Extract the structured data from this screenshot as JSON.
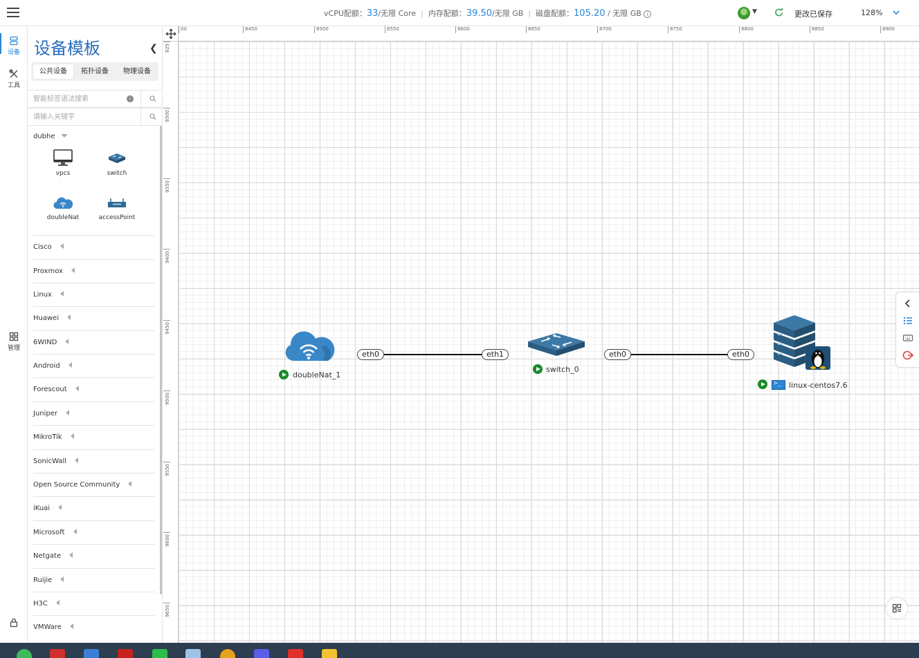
{
  "topbar": {
    "vcpu_label": "vCPU配额：",
    "vcpu_value": "33",
    "vcpu_suffix": "/无限 Core",
    "mem_label": "内存配额：",
    "mem_value": "39.50",
    "mem_suffix": "/无限 GB",
    "disk_label": "磁盘配额：",
    "disk_value": "105.20",
    "disk_suffix": " / 无限 GB",
    "save_status": "更改已保存",
    "zoom": "128%"
  },
  "rail": {
    "device": "设备",
    "tool": "工具",
    "manage": "管理"
  },
  "sidebar": {
    "title": "设备模板",
    "tabs": [
      "公共设备",
      "拓扑设备",
      "物理设备"
    ],
    "search_tag_placeholder": "智能标签语法搜索",
    "search_kw_placeholder": "请输入关键字",
    "open_group": "dubhe",
    "devices": [
      "vpcs",
      "switch",
      "doubleNat",
      "accessPoint"
    ],
    "vendors": [
      "Cisco",
      "Proxmox",
      "Linux",
      "Huawei",
      "6WIND",
      "Android",
      "Forescout",
      "Juniper",
      "MikroTik",
      "SonicWall",
      "Open Source Community",
      "iKuai",
      "Microsoft",
      "Netgate",
      "Ruijie",
      "H3C",
      "VMWare"
    ]
  },
  "ruler": {
    "top": [
      "00",
      "8450",
      "8500",
      "8550",
      "8600",
      "8650",
      "8700",
      "8750",
      "8800",
      "8850",
      "8900"
    ],
    "left": [
      "925",
      "9300",
      "9350",
      "9400",
      "9450",
      "9500",
      "9550",
      "9600",
      "9650"
    ]
  },
  "topology": {
    "nodes": [
      "doubleNat_1",
      "switch_0",
      "linux-centos7.6"
    ],
    "ports": [
      "eth0",
      "eth1",
      "eth0",
      "eth0"
    ]
  },
  "colors": {
    "accent": "#2a86d6",
    "running": "#1a8a2a",
    "device_blue": "#2e6a94"
  }
}
